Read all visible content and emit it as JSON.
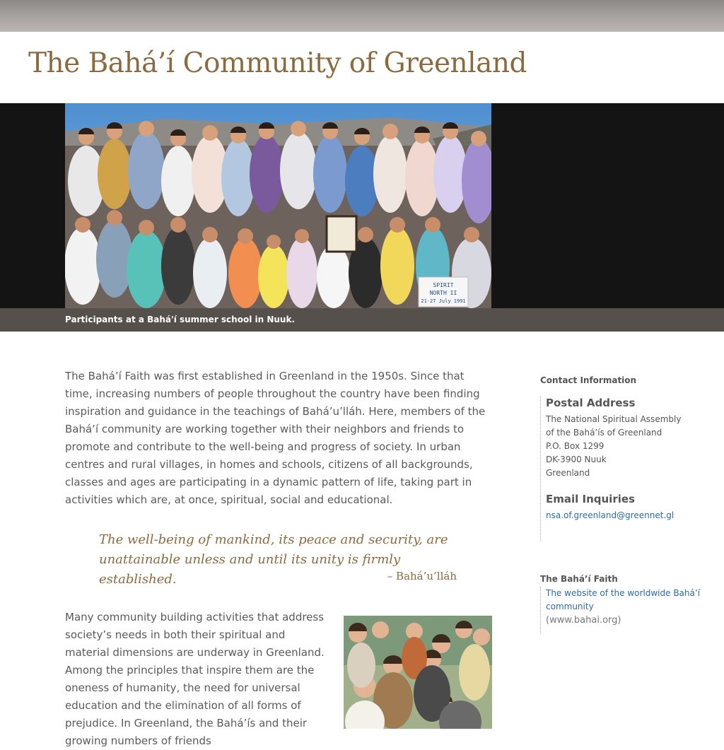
{
  "header": {
    "title": "The Bahá’í Community of Greenland"
  },
  "hero": {
    "caption": "Participants at a Bahá'í summer school in Nuuk."
  },
  "hero_sign": {
    "line1": "SPIRIT",
    "line2": "NORTH II",
    "line3": "21-27 July 1991"
  },
  "intro": {
    "paragraph": "The Bahá’í Faith was first established in Greenland in the 1950s. Since that time, increasing numbers of people throughout the country have been finding inspiration and guidance in the teachings of Bahá’u’lláh. Here, members of the Bahá’í community are working together with their neighbors and friends to promote and contribute to the well-being and progress of society. In urban centres and rural villages, in homes and schools, citizens of all backgrounds, classes and ages are participating in a dynamic pattern of life, taking part in activities which are, at once, spiritual, social and educational."
  },
  "quote": {
    "text": "The well-being of mankind, its peace and security, are unattainable unless and until its unity is firmly established.",
    "attribution": "– Bahá’u’lláh"
  },
  "body2": {
    "paragraph": "Many community building activities that address society’s needs in both their spiritual and material dimensions are underway in Greenland. Among the principles that inspire them are the oneness of humanity, the need for universal education and the elimination of all forms of prejudice. In Greenland, the Bahá’ís and their growing numbers of friends"
  },
  "sidebar": {
    "contact_heading": "Contact Information",
    "postal_title": "Postal Address",
    "address_lines": [
      "The National Spiritual Assembly",
      "of the Bahá’ís of Greenland",
      "P.O. Box 1299",
      "DK-3900 Nuuk",
      "Greenland"
    ],
    "email_title": "Email Inquiries",
    "email": "nsa.of.greenland@greennet.gl",
    "faith_heading": "The Bahá’í Faith",
    "faith_link": "The website of the worldwide Bahá’í community",
    "faith_url": "(www.bahai.org)"
  },
  "colors": {
    "title_brown": "#8b6a3e",
    "caption_bar": "#55504c",
    "hero_band": "#141414",
    "link_blue": "#2b6ca3"
  }
}
